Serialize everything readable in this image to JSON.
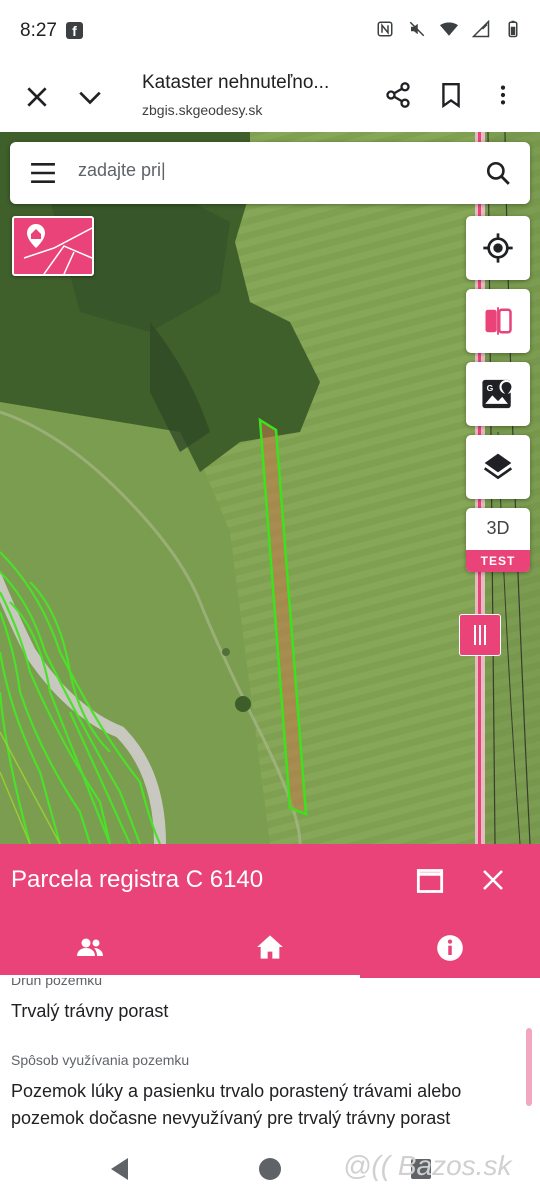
{
  "status": {
    "time": "8:27",
    "fb_glyph": "f"
  },
  "browser": {
    "title": "Kataster nehnuteľno...",
    "url": "zbgis.skgeodesy.sk"
  },
  "search": {
    "value": "zadajte pri|",
    "placeholder": ""
  },
  "map_buttons": {
    "three_d_label": "3D",
    "test_label": "TEST"
  },
  "panel": {
    "title": "Parcela registra C 6140",
    "fields": [
      {
        "label": "Druh pozemku",
        "value": "Trvalý trávny porast"
      },
      {
        "label": "Spôsob využívania pozemku",
        "value": "Pozemok lúky a pasienku trvalo porastený trávami alebo pozemok dočasne nevyužívaný pre trvalý trávny porast"
      }
    ]
  },
  "watermark": "@(( Bazos.sk",
  "colors": {
    "accent": "#e9437a",
    "parcel_outline": "#3ee21c"
  }
}
